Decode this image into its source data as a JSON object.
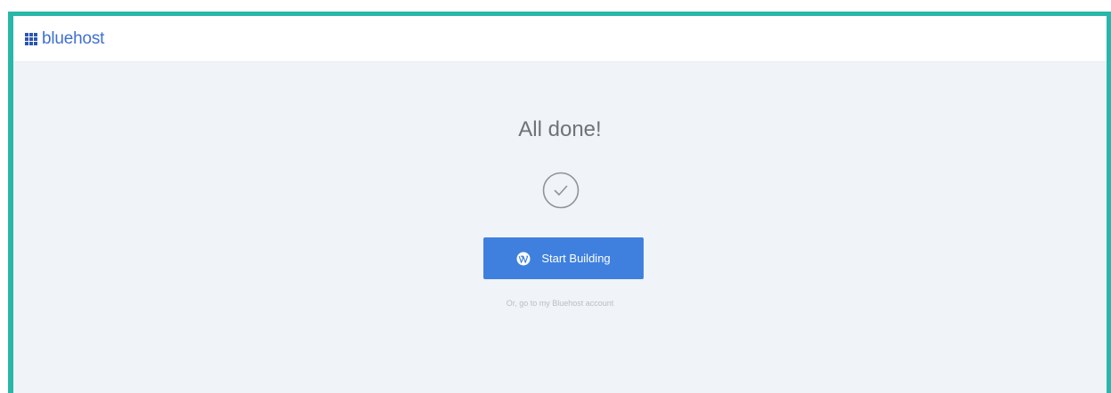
{
  "header": {
    "logo_text": "bluehost",
    "logo_icon": "grid-icon",
    "brand_color": "#3f6fd4"
  },
  "main": {
    "title": "All done!",
    "status_icon": "checkmark-circle-icon",
    "cta": {
      "label": "Start Building",
      "icon": "wordpress-icon",
      "color": "#3f80df"
    },
    "alt_link": "Or, go to my Bluehost account"
  },
  "frame": {
    "accent_color": "#2ab7a9",
    "background": "#f0f3f7"
  }
}
